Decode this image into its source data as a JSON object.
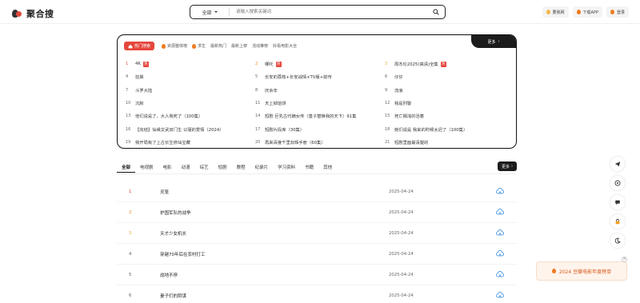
{
  "header": {
    "logo_text": "聚合搜",
    "search_category": "全部",
    "search_placeholder": "请输入搜索关键词",
    "buttons": [
      {
        "label": "要我网",
        "icon": "hand-icon"
      },
      {
        "label": "下载APP",
        "icon": "flame-icon"
      },
      {
        "label": "登录",
        "icon": "flame-icon"
      }
    ]
  },
  "hot": {
    "tag_label": "热门搜索",
    "tabs": [
      "资源整体榜",
      "求生",
      "最新热门",
      "最新上架",
      "活动推荐",
      "好看电影大全"
    ],
    "more_label": "更多",
    "items": [
      {
        "num": "1",
        "title": "4K",
        "badge": "热"
      },
      {
        "num": "2",
        "title": "哪吒",
        "badge": "热"
      },
      {
        "num": "3",
        "title": "周杰伦2025(高清)全集",
        "badge": "热"
      },
      {
        "num": "4",
        "title": "狂飙",
        "badge": ""
      },
      {
        "num": "5",
        "title": "长安的荔枝+长安战情+TV版+前传",
        "badge": ""
      },
      {
        "num": "6",
        "title": "仔仔",
        "badge": ""
      },
      {
        "num": "7",
        "title": "斗罗大陆",
        "badge": ""
      },
      {
        "num": "8",
        "title": "庆余年",
        "badge": ""
      },
      {
        "num": "9",
        "title": "流浪",
        "badge": ""
      },
      {
        "num": "10",
        "title": "沉默",
        "badge": ""
      },
      {
        "num": "11",
        "title": "天上掉馅饼",
        "badge": ""
      },
      {
        "num": "12",
        "title": "我是刑警",
        "badge": ""
      },
      {
        "num": "13",
        "title": "他们说是了，大人我死了（100集）",
        "badge": ""
      },
      {
        "num": "14",
        "title": "短剧 巨乳古代嫡女传（皇子替换我的天下）91集",
        "badge": ""
      },
      {
        "num": "15",
        "title": "死亡搁浅的活着",
        "badge": ""
      },
      {
        "num": "16",
        "title": "【完结】仙缘文武双门生 公瑾的爱情（2024）",
        "badge": ""
      },
      {
        "num": "17",
        "title": "短剧片段库（30集）",
        "badge": ""
      },
      {
        "num": "18",
        "title": "她们说是 我来的时候太迟了（100集）",
        "badge": ""
      },
      {
        "num": "19",
        "title": "我开局有了上古长生修仙宝藏",
        "badge": ""
      },
      {
        "num": "20",
        "title": "再来百度千里双辉手册（60集）",
        "badge": ""
      },
      {
        "num": "21",
        "title": "短剧里面最清楚的",
        "badge": ""
      }
    ]
  },
  "categories": {
    "tabs": [
      "全部",
      "电视剧",
      "电影",
      "动漫",
      "综艺",
      "短剧",
      "教程",
      "纪录片",
      "学习资料",
      "书籍",
      "其他"
    ],
    "active": "全部",
    "more_label": "更多"
  },
  "list": [
    {
      "num": "1",
      "title": "灵笼",
      "date": "2025-04-24"
    },
    {
      "num": "2",
      "title": "护国军队的战争",
      "date": "2025-04-24"
    },
    {
      "num": "3",
      "title": "天才少女机长",
      "date": "2025-04-24"
    },
    {
      "num": "4",
      "title": "穿越70年后在农村打工",
      "date": "2025-04-24"
    },
    {
      "num": "5",
      "title": "战地不停",
      "date": "2025-04-24"
    },
    {
      "num": "6",
      "title": "妻子们的阴谋",
      "date": "2025-04-24"
    }
  ],
  "banner": {
    "text": "2024 豆瓣电影年度榜单"
  },
  "colors": {
    "accent_red": "#e5463c",
    "dark": "#1c1c1c",
    "cloud_blue": "#3b8fe0",
    "banner_orange": "#d6591d"
  }
}
